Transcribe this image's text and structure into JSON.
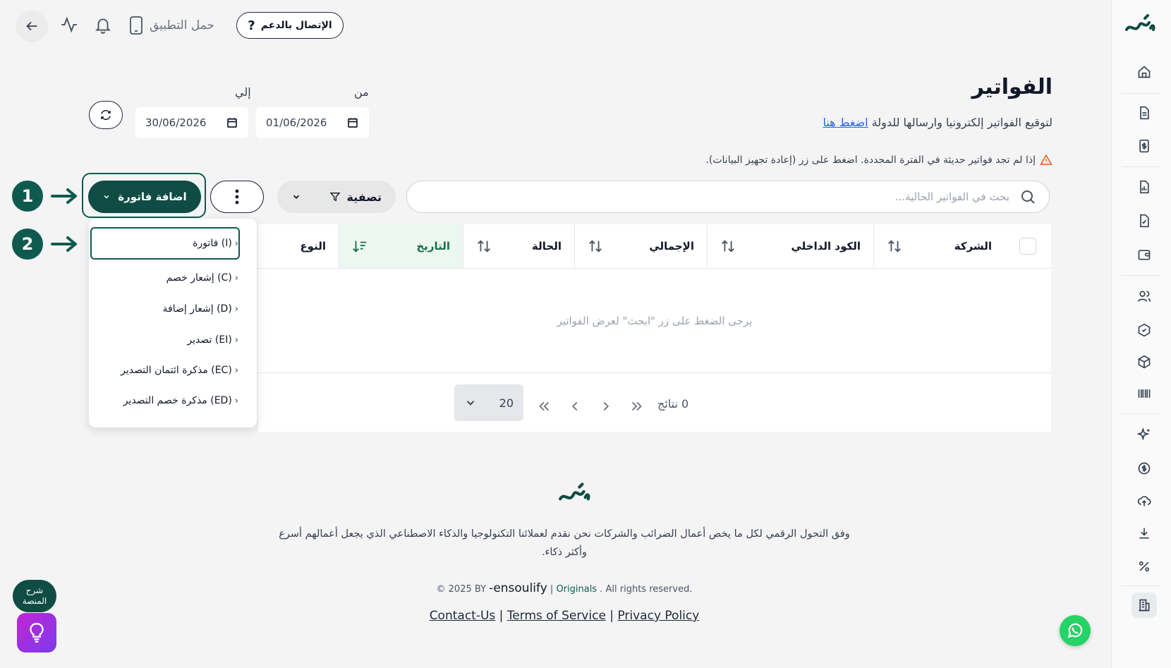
{
  "topbar": {
    "app_label": "حمل التطبيق",
    "support_label": "الإتصال بالدعم"
  },
  "header": {
    "title": "الفواتير",
    "subtitle": "لتوقيع الفواتير إلكترونيا وارسالها للدولة",
    "subtitle_link": "اضغط هنا",
    "warning": "إذا لم تجد فواتير حديثة في الفترة المحددة. اضغط على زر (إعادة تجهيز البيانات)."
  },
  "dates": {
    "from_label": "من",
    "from_value": "01/06/2026",
    "to_label": "إلي",
    "to_value": "30/06/2026"
  },
  "toolbar": {
    "search_placeholder": "بحث في الفواتير الحالية...",
    "filter_label": "تصفية",
    "add_label": "اضافة فاتورة"
  },
  "steps": [
    "1",
    "2"
  ],
  "dropdown": {
    "items": [
      "فاتورة (I)",
      "إشعار خصم (C)",
      "إشعار إضافة (D)",
      "تصدير (EI)",
      "مذكرة ائتمان التصدير (EC)",
      "مذكرة خصم التصدير (ED)"
    ]
  },
  "table": {
    "columns": [
      "الشركة",
      "الكود الداخلي",
      "الإجمالي",
      "الحالة",
      "التاريخ",
      "النوع"
    ],
    "empty_message": "يرجى الضغط على زر \"ابحث\" لعرض الفواتير",
    "results": "0 نتائج",
    "page_size": "20"
  },
  "footer": {
    "about": "وفق التحول الرقمي لكل ما يخص أعمال الضرائب والشركات نحن نقدم لعملائنا التكنولوجيا والذكاء الاصطناعي الذي يجعل أعمالهم أسرع وأكثر ذكاء.",
    "copyright_prefix": "© 2025 BY",
    "brand": "ensoulify",
    "originals": "Originals",
    "rights": ". All rights reserved.",
    "links": [
      "Contact-Us",
      "Terms of Service",
      "Privacy Policy"
    ]
  },
  "floating": {
    "tour_line1": "شرح",
    "tour_line2": "المنصة"
  },
  "colors": {
    "brand": "#0f4c44",
    "accent_green": "#166e50",
    "link": "#2563eb",
    "warning": "#ea580c"
  }
}
